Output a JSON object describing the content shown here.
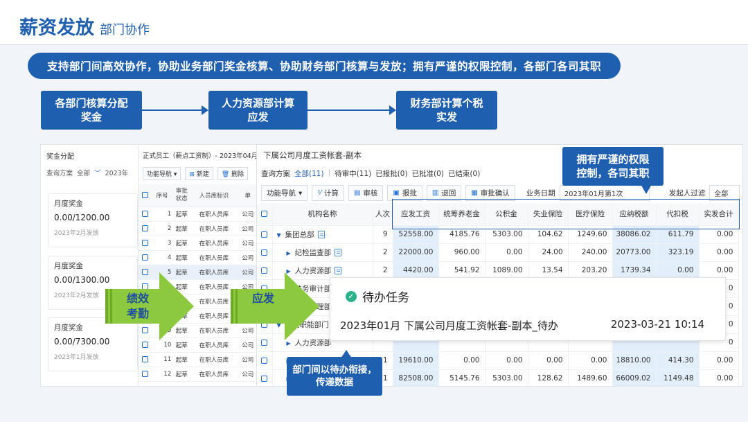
{
  "slide": {
    "title": "薪资发放",
    "subtitle": "部门协作",
    "banner": "支持部门间高效协作，协助业务部门奖金核算、协助财务部门核算与发放；拥有严谨的权限控制，各部门各司其职"
  },
  "flow": [
    {
      "label": "各部门核算分配\n奖金"
    },
    {
      "label": "人力资源部计算\n应发"
    },
    {
      "label": "财务部计算个税\n实发"
    }
  ],
  "bonus_panel": {
    "title": "奖金分配",
    "filter_label": "查询方案",
    "filter_value": "全部",
    "year": "2023年",
    "cards": [
      {
        "label": "月度奖金",
        "value": "0.00/1200.00",
        "date": "2023年2月发放"
      },
      {
        "label": "月度奖金",
        "value": "0.00/1300.00",
        "date": "2023年2月发放"
      },
      {
        "label": "月度奖金",
        "value": "0.00/7300.00",
        "date": "2023年1月发放"
      }
    ]
  },
  "emp_panel": {
    "title": "正式员工（薪点工资制）- 2023年04月",
    "toolbar": {
      "nav": "功能导航",
      "new": "新建",
      "delete": "删除"
    },
    "columns": [
      "序号",
      "审批状态",
      "人员库标识",
      "单"
    ],
    "rows": [
      {
        "no": "1",
        "status": "起草",
        "lib": "在职人员库",
        "unit": "公司"
      },
      {
        "no": "2",
        "status": "起草",
        "lib": "在职人员库",
        "unit": "公司"
      },
      {
        "no": "3",
        "status": "起草",
        "lib": "在职人员库",
        "unit": "公司"
      },
      {
        "no": "4",
        "status": "起草",
        "lib": "在职人员库",
        "unit": "公司"
      },
      {
        "no": "5",
        "status": "起草",
        "lib": "在职人员库",
        "unit": "公司"
      },
      {
        "no": "6",
        "status": "起草",
        "lib": "在职人员库",
        "unit": "公司"
      },
      {
        "no": "7",
        "status": "起草",
        "lib": "在职人员库",
        "unit": "公司"
      },
      {
        "no": "8",
        "status": "起草",
        "lib": "在职人员库",
        "unit": "公司"
      },
      {
        "no": "9",
        "status": "起草",
        "lib": "在职人员库",
        "unit": "公司"
      },
      {
        "no": "10",
        "status": "起草",
        "lib": "在职人员库",
        "unit": "公司"
      },
      {
        "no": "11",
        "status": "起草",
        "lib": "在职人员库",
        "unit": "公司"
      },
      {
        "no": "12",
        "status": "起草",
        "lib": "在职人员库",
        "unit": "公司"
      }
    ]
  },
  "pay_panel": {
    "title": "下属公司月度工资帐套-副本",
    "filter": {
      "label": "查询方案",
      "all": "全部(11)",
      "reviewing": "待审中(11)",
      "reported": "已报批(0)",
      "approved": "已批准(0)",
      "closed": "已结束(0)"
    },
    "toolbar": {
      "nav": "功能导航",
      "calc": "计算",
      "review": "审核",
      "report": "报批",
      "back": "退回",
      "confirm": "审批确认",
      "date_label": "业务日期",
      "date_value": "2023年01月第1次",
      "initiator_label": "发起人过滤",
      "initiator_value": "全部"
    },
    "columns": [
      "机构名称",
      "人次",
      "应发工资",
      "统筹养老金",
      "公积金",
      "失业保险",
      "医疗保险",
      "应纳税额",
      "代扣税",
      "实发合计"
    ],
    "rows": [
      {
        "name": "集团总部",
        "expanded": true,
        "indent": 0,
        "count": "9",
        "sal": "52558.00",
        "pension": "4185.76",
        "fund": "5303.00",
        "unemp": "104.62",
        "med": "1249.60",
        "tax": "38086.02",
        "wh": "611.79",
        "net": "0.00"
      },
      {
        "name": "纪检监查部",
        "expanded": false,
        "indent": 1,
        "count": "2",
        "sal": "22000.00",
        "pension": "960.00",
        "fund": "0.00",
        "unemp": "24.00",
        "med": "240.00",
        "tax": "20773.00",
        "wh": "323.19",
        "net": "0.00"
      },
      {
        "name": "人力资源部",
        "expanded": false,
        "indent": 1,
        "count": "2",
        "sal": "4420.00",
        "pension": "541.92",
        "fund": "1089.00",
        "unemp": "13.54",
        "med": "203.20",
        "tax": "1739.34",
        "wh": "0.00",
        "net": "0.00"
      },
      {
        "name": "法务审计部",
        "expanded": false,
        "indent": 1,
        "count": "",
        "sal": "",
        "pension": "",
        "fund": "",
        "unemp": "",
        "med": "",
        "tax": "",
        "wh": "",
        "net": "0"
      },
      {
        "name": "施工管理部",
        "expanded": false,
        "indent": 1,
        "count": "",
        "sal": "",
        "pension": "",
        "fund": "",
        "unemp": "",
        "med": "",
        "tax": "",
        "wh": "",
        "net": "0"
      },
      {
        "name": "机关职能部门",
        "expanded": true,
        "indent": 0,
        "count": "",
        "sal": "",
        "pension": "",
        "fund": "",
        "unemp": "",
        "med": "",
        "tax": "",
        "wh": "",
        "net": "0"
      },
      {
        "name": "人力资源部",
        "expanded": false,
        "indent": 1,
        "count": "",
        "sal": "",
        "pension": "",
        "fund": "",
        "unemp": "",
        "med": "",
        "tax": "",
        "wh": "",
        "net": "0"
      },
      {
        "name": "施工管理部",
        "expanded": false,
        "indent": 1,
        "count": "1",
        "sal": "19610.00",
        "pension": "0.00",
        "fund": "0.00",
        "unemp": "0.00",
        "med": "0.00",
        "tax": "18810.00",
        "wh": "414.30",
        "net": "0.00"
      },
      {
        "name": "",
        "expanded": false,
        "indent": 1,
        "count": "1",
        "sal": "82508.00",
        "pension": "5145.76",
        "fund": "5303.00",
        "unemp": "128.62",
        "med": "1489.60",
        "tax": "66009.02",
        "wh": "1149.48",
        "net": "0.00"
      }
    ]
  },
  "callout": "拥有严谨的权限\n控制，各司其职",
  "task_card": {
    "header": "待办任务",
    "name": "2023年01月 下属公司月度工资帐套-副本_待办",
    "time": "2023-03-21 10:14"
  },
  "arrows": [
    {
      "label": "绩效\n考勤"
    },
    {
      "label": "应发"
    }
  ],
  "handoff": "部门间以待办衔接，\n传递数据",
  "colors": {
    "brand": "#1f5fb0",
    "arrow_green": "#8cc93f",
    "highlight": "#e3eefb",
    "check_green": "#2cb38c"
  }
}
